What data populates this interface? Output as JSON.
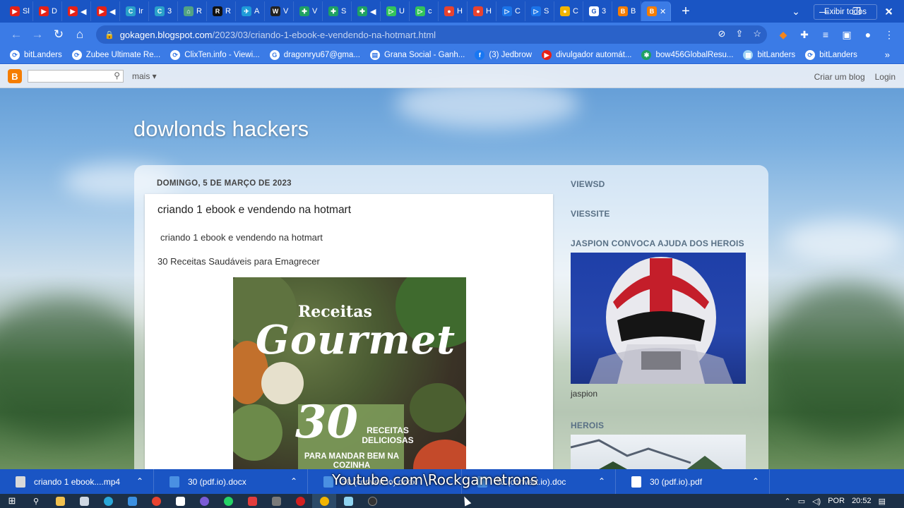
{
  "tabs": [
    {
      "label": "Sl",
      "color": "#e62117",
      "glyph": "▶"
    },
    {
      "label": "D",
      "color": "#e62117",
      "glyph": "▶"
    },
    {
      "label": "◀",
      "color": "#e62117",
      "glyph": "▶"
    },
    {
      "label": "◀",
      "color": "#e62117",
      "glyph": "▶"
    },
    {
      "label": "Ir",
      "color": "#2aa1c9",
      "glyph": "C"
    },
    {
      "label": "3",
      "color": "#2aa1c9",
      "glyph": "C"
    },
    {
      "label": "R",
      "color": "#52a383",
      "glyph": "⌂"
    },
    {
      "label": "R",
      "color": "#111111",
      "glyph": "R"
    },
    {
      "label": "A",
      "color": "#1f9bd8",
      "glyph": "✈"
    },
    {
      "label": "V",
      "color": "#222222",
      "glyph": "W"
    },
    {
      "label": "V",
      "color": "#1fa163",
      "glyph": "✚"
    },
    {
      "label": "S",
      "color": "#1fa163",
      "glyph": "✚"
    },
    {
      "label": "◀",
      "color": "#1fa163",
      "glyph": "✚"
    },
    {
      "label": "U",
      "color": "#33c45a",
      "glyph": "▷"
    },
    {
      "label": "c",
      "color": "#33c45a",
      "glyph": "▷"
    },
    {
      "label": "H",
      "color": "#e8432f",
      "glyph": "●"
    },
    {
      "label": "H",
      "color": "#e8432f",
      "glyph": "●"
    },
    {
      "label": "C",
      "color": "#1b74e8",
      "glyph": "▷"
    },
    {
      "label": "S",
      "color": "#1b74e8",
      "glyph": "▷"
    },
    {
      "label": "C",
      "color": "#f2b400",
      "glyph": "●"
    },
    {
      "label": "3",
      "color": "#ffffff",
      "glyph": "G"
    },
    {
      "label": "B",
      "color": "#f57d00",
      "glyph": "B"
    },
    {
      "label": "✕",
      "color": "#f57d00",
      "glyph": "B"
    }
  ],
  "address": {
    "host": "gokagen.blogspot.com",
    "path": "/2023/03/criando-1-ebook-e-vendendo-na-hotmart.html"
  },
  "bookmarks": [
    {
      "label": "bitLanders",
      "color": "#ffffff",
      "glyph": "⟳"
    },
    {
      "label": "Zubee Ultimate Re...",
      "color": "#ffffff",
      "glyph": "⟳"
    },
    {
      "label": "ClixTen.info - Viewi...",
      "color": "#ffffff",
      "glyph": "⟳"
    },
    {
      "label": "dragonryu67@gma...",
      "color": "#ffffff",
      "glyph": "G"
    },
    {
      "label": "Grana Social - Ganh...",
      "color": "#ffffff",
      "glyph": "▤"
    },
    {
      "label": "(3) Jedbrow",
      "color": "#1877f2",
      "glyph": "f"
    },
    {
      "label": "divulgador automát...",
      "color": "#e62117",
      "glyph": "▶"
    },
    {
      "label": "bow456GlobalResu...",
      "color": "#1fa163",
      "glyph": "✱"
    },
    {
      "label": "bitLanders",
      "color": "#9fd3f5",
      "glyph": "▦"
    },
    {
      "label": "bitLanders",
      "color": "#ffffff",
      "glyph": "⟳"
    }
  ],
  "blogger": {
    "more_label": "mais",
    "create_label": "Criar um blog",
    "login_label": "Login"
  },
  "blog": {
    "title": "dowlonds hackers",
    "date": "DOMINGO, 5 DE MARÇO DE 2023",
    "post_title": "criando 1 ebook e vendendo na hotmart",
    "post_line1": "criando 1 ebook e vendendo na hotmart",
    "post_line2": "30 Receitas Saudáveis para Emagrecer",
    "cover": {
      "top": "Receitas",
      "main": "Gourmet",
      "number": "30",
      "sub1": "RECEITAS DELICIOSAS",
      "sub2": "PARA MANDAR BEM NA COZINHA"
    }
  },
  "sidebar": {
    "h1": "VIEWSD",
    "h2": "VIESSITE",
    "h3": "JASPION CONVOCA AJUDA DOS HEROIS",
    "caption": "jaspion",
    "h4": "HEROIS"
  },
  "downloads": [
    {
      "label": "criando 1 ebook....mp4",
      "color": "#d9d9d9"
    },
    {
      "label": "30 (pdf.io).docx",
      "color": "#4a90e2"
    },
    {
      "label": "30 (convert.io).docx",
      "color": "#4a90e2"
    },
    {
      "label": "30 (convert.io).doc",
      "color": "#4a90e2"
    },
    {
      "label": "30 (pdf.io).pdf",
      "color": "#ffffff"
    }
  ],
  "downloads_show_all": "Exibir todos",
  "watermark": "Youtube.com\\Rockgametrons",
  "tray": {
    "lang": "POR",
    "time": "20:52"
  }
}
